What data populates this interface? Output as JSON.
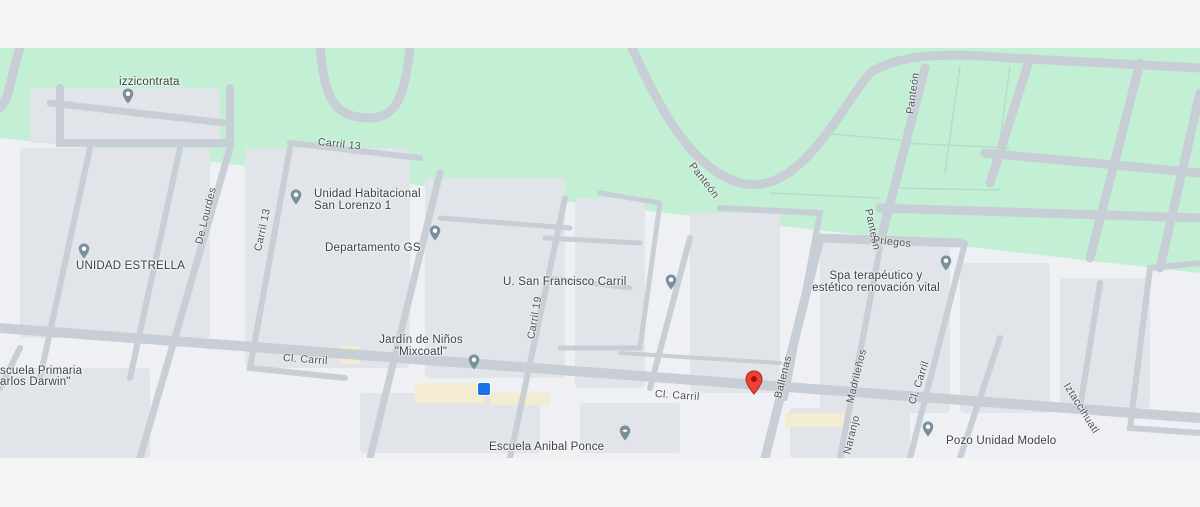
{
  "map": {
    "places": {
      "izzi": "izzicontrata",
      "unidad_habitacional": "Unidad Habitacional\nSan Lorenzo 1",
      "departamento": "Departamento GS",
      "unidad_estrella": "UNIDAD ESTRELLA",
      "san_francisco": "U. San Francisco Carril",
      "spa": "Spa terapéutico y\nestético renovación vital",
      "jardin": "Jardín de Niños\n\"Mixcoatl\"",
      "escuela_primaria": "scuela Primaria\narlos Darwin\"",
      "escuela_anibal": "Escuela Anibal Ponce",
      "pozo": "Pozo Unidad Modelo"
    },
    "streets": {
      "carril13_top": "Carril 13",
      "de_lourdes": "De Lourdes",
      "carril13_side": "Carril 13",
      "carril19": "Carril 19",
      "panteon_a": "Panteón",
      "panteon_b": "Panteón",
      "panteon_c": "Panteón",
      "priegos": "Priegos",
      "cl_carril_a": "Cl. Carril",
      "cl_carril_b": "Cl. Carril",
      "ballenas": "Ballenas",
      "madrilenos": "Madrileños",
      "naranjo": "Naranjo",
      "cl_carril_c": "Cl. Carril",
      "iztaccihuatl": "Iztaccihuatl"
    },
    "colors": {
      "park": "#c3efd5",
      "road": "#c8ced6",
      "block": "#e1e4e8",
      "poi_pin": "#78909c",
      "marker": "#ea4335",
      "transit": "#1a73e8"
    },
    "icons": {
      "poi": "map-pin-icon",
      "school": "school-icon",
      "bus": "bus-stop-icon",
      "marker": "location-marker-icon"
    }
  }
}
